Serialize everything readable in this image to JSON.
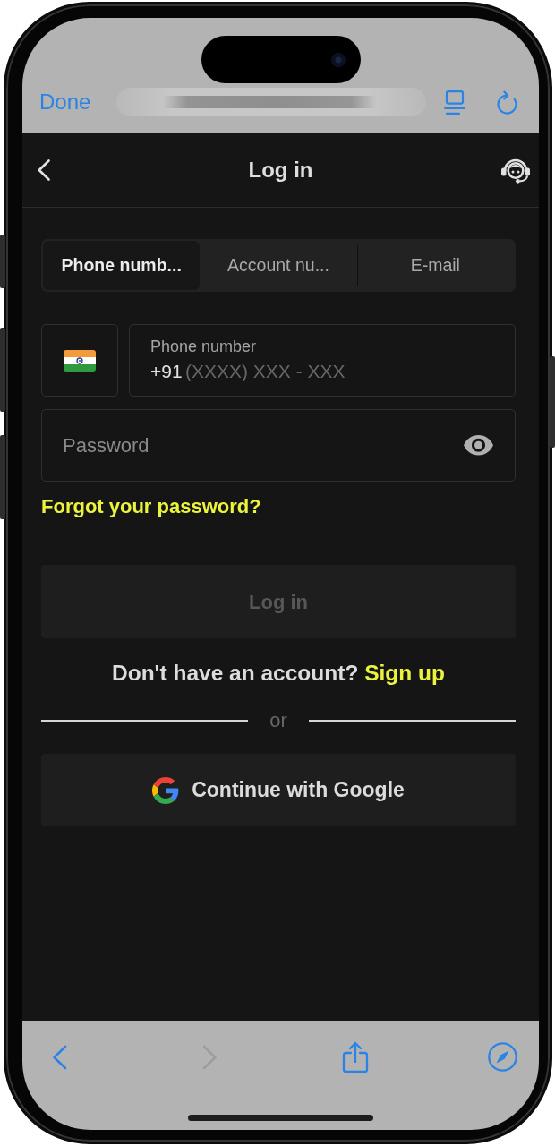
{
  "browser_bar": {
    "done_label": "Done"
  },
  "header": {
    "title": "Log in"
  },
  "login_tabs": [
    {
      "label": "Phone numb...",
      "selected": true
    },
    {
      "label": "Account nu...",
      "selected": false
    },
    {
      "label": "E-mail",
      "selected": false
    }
  ],
  "phone_field": {
    "label": "Phone number",
    "prefix": "+91",
    "placeholder": "(XXXX) XXX - XXX"
  },
  "password_field": {
    "placeholder": "Password"
  },
  "forgot_link": "Forgot your password?",
  "login_button": {
    "label": "Log in",
    "disabled": true
  },
  "signup_prompt": {
    "text": "Don't have an account?",
    "link": "Sign up"
  },
  "divider_label": "or",
  "google_button": {
    "label": "Continue with Google"
  },
  "toolbar_buttons": [
    {
      "kind": "back",
      "disabled": false
    },
    {
      "kind": "forward",
      "disabled": true
    },
    {
      "kind": "share",
      "disabled": false
    },
    {
      "kind": "compass",
      "disabled": false
    }
  ]
}
